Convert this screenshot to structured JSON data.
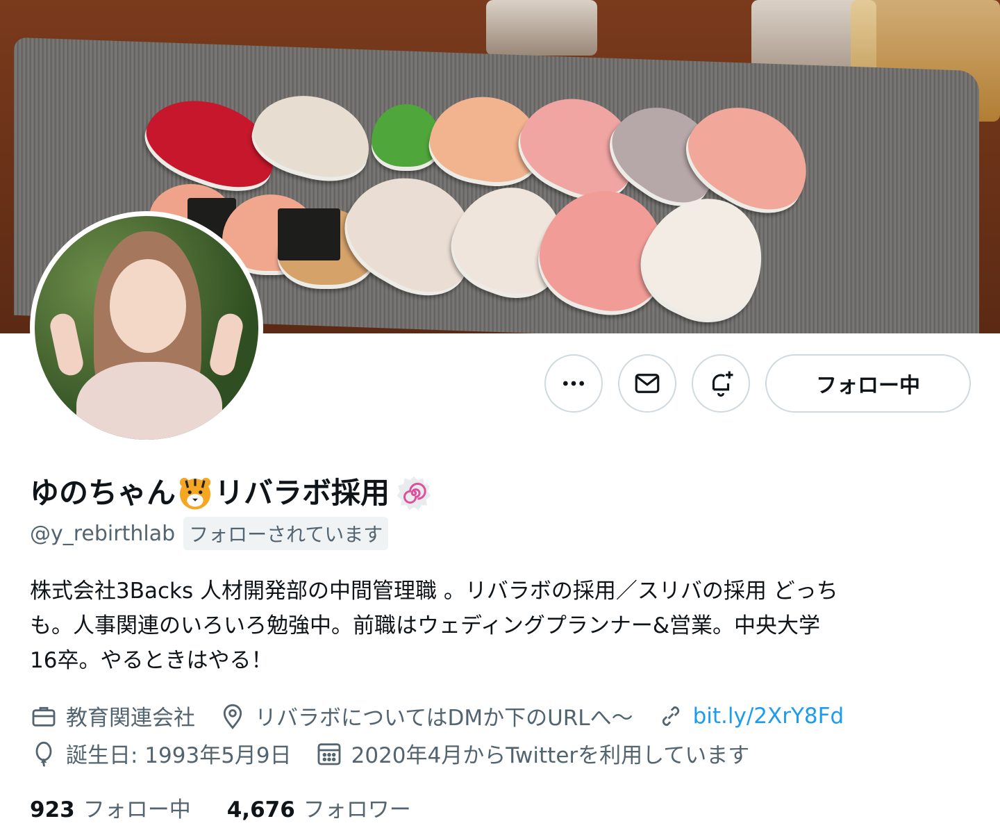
{
  "profile": {
    "name_part1": "ゆのちゃん",
    "name_part2": "リバラボ採用",
    "handle": "@y_rebirthlab",
    "follows_you": "フォローされています",
    "bio": "株式会社3Backs 人材開発部の中間管理職 。リバラボの採用／スリバの採用 どっち\nも。人事関連のいろいろ勉強中。前職はウェディングプランナー&営業。中央大学\n16卒。やるときはやる！",
    "category": "教育関連会社",
    "location": "リバラボについてはDMか下のURLへ〜",
    "url": "bit.ly/2XrY8Fd",
    "birthday": "誕生日: 1993年5月9日",
    "joined": "2020年4月からTwitterを利用しています"
  },
  "actions": {
    "follow_label": "フォロー中"
  },
  "stats": {
    "following_count": "923",
    "following_label": "フォロー中",
    "followers_count": "4,676",
    "followers_label": "フォロワー"
  },
  "icons": {
    "name_emoji": "tiger-face-emoji",
    "badge": "naruto-swirl-icon",
    "more": "more-dots-icon",
    "message": "envelope-icon",
    "notify": "bell-plus-icon",
    "category": "briefcase-icon",
    "location": "location-pin-icon",
    "link": "link-icon",
    "birthday": "balloon-icon",
    "joined": "calendar-icon"
  },
  "colors": {
    "link": "#1d9bf0",
    "secondary_text": "#536471",
    "border": "#cfd9de"
  }
}
